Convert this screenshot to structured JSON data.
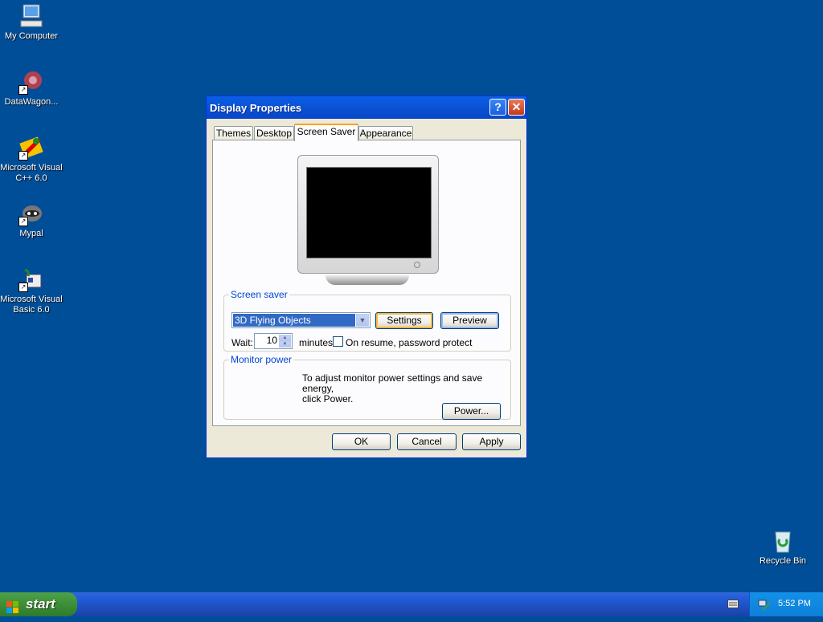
{
  "desktop": {
    "icons": [
      {
        "label": "My Computer"
      },
      {
        "label": "DataWagon..."
      },
      {
        "label_line1": "Microsoft Visual",
        "label_line2": "C++ 6.0"
      },
      {
        "label": "Mypal"
      },
      {
        "label_line1": "Microsoft Visual",
        "label_line2": "Basic 6.0"
      },
      {
        "label": "Recycle Bin"
      }
    ]
  },
  "dialog": {
    "title": "Display Properties",
    "help_button": "?",
    "close_button": "✕",
    "tabs": [
      "Themes",
      "Desktop",
      "Screen Saver",
      "Appearance"
    ],
    "active_tab": "Screen Saver",
    "screen_saver": {
      "group_label": "Screen saver",
      "selected": "3D Flying Objects",
      "settings_label": "Settings",
      "preview_label": "Preview",
      "wait_label": "Wait:",
      "wait_value": "10",
      "minutes_label": "minutes",
      "password_label": "On resume, password protect",
      "password_checked": false
    },
    "monitor_power": {
      "group_label": "Monitor power",
      "text_line1": "To adjust monitor power settings and save energy,",
      "text_line2": "click Power.",
      "power_label": "Power..."
    },
    "buttons": {
      "ok": "OK",
      "cancel": "Cancel",
      "apply": "Apply"
    }
  },
  "taskbar": {
    "start_label": "start",
    "clock": "5:52 PM"
  },
  "colors": {
    "desktop": "#004e98",
    "titlebar": "#0b54d6",
    "start": "#3c8f37"
  }
}
